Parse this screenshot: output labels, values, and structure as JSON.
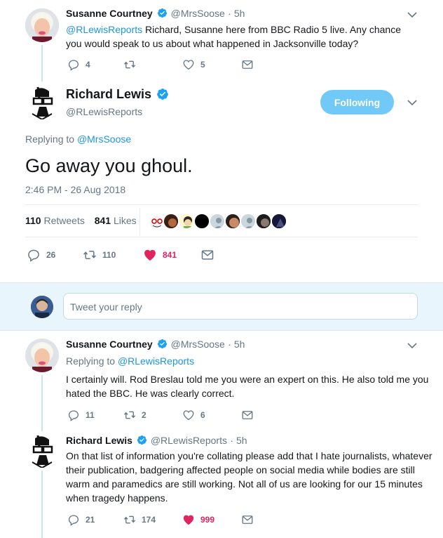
{
  "tweet1": {
    "name": "Susanne Courtney",
    "handle": "@MrsSoose",
    "time": "5h",
    "mention": "@RLewisReports",
    "text": " Richard, Susanne here from BBC Radio 5 live. Any chance you would speak to us about what happened in Jacksonville today?",
    "replies": "4",
    "retweets": "",
    "likes": "5"
  },
  "main": {
    "name": "Richard Lewis",
    "handle": "@RLewisReports",
    "follow_label": "Following",
    "replying_prefix": "Replying to ",
    "replying_to": "@MrsSoose",
    "text": "Go away you ghoul.",
    "timestamp": "2:46 PM - 26 Aug 2018",
    "retweets_count": "110",
    "retweets_label": "Retweets",
    "likes_count": "841",
    "likes_label": "Likes",
    "action_replies": "26",
    "action_retweets": "110",
    "action_likes": "841"
  },
  "composer": {
    "placeholder": "Tweet your reply"
  },
  "reply1": {
    "name": "Susanne Courtney",
    "handle": "@MrsSoose",
    "time": "5h",
    "replying_prefix": "Replying to ",
    "replying_to": "@RLewisReports",
    "text": "I certainly will. Rod Breslau told me you were an expert on this. He also told me you hated the BBC. He was clearly correct.",
    "replies": "11",
    "retweets": "2",
    "likes": "6"
  },
  "reply2": {
    "name": "Richard Lewis",
    "handle": "@RLewisReports",
    "time": "5h",
    "text": "On that list of information you're collating please add that I hate journalists, whatever their publication, badgering affected people on social media while bodies are still warm and paramedics are still working. Not all of us are looking for our 15 minutes when tragedy happens.",
    "replies": "21",
    "retweets": "174",
    "likes": "999"
  },
  "colors": {
    "accent": "#1da1f2",
    "link": "#1b95e0",
    "like": "#e0245e",
    "muted": "#657786",
    "follow_bg": "#71c9f8"
  },
  "icons": [
    "reply-icon",
    "retweet-icon",
    "like-icon",
    "dm-icon",
    "verified-icon",
    "chevron-down-icon"
  ]
}
